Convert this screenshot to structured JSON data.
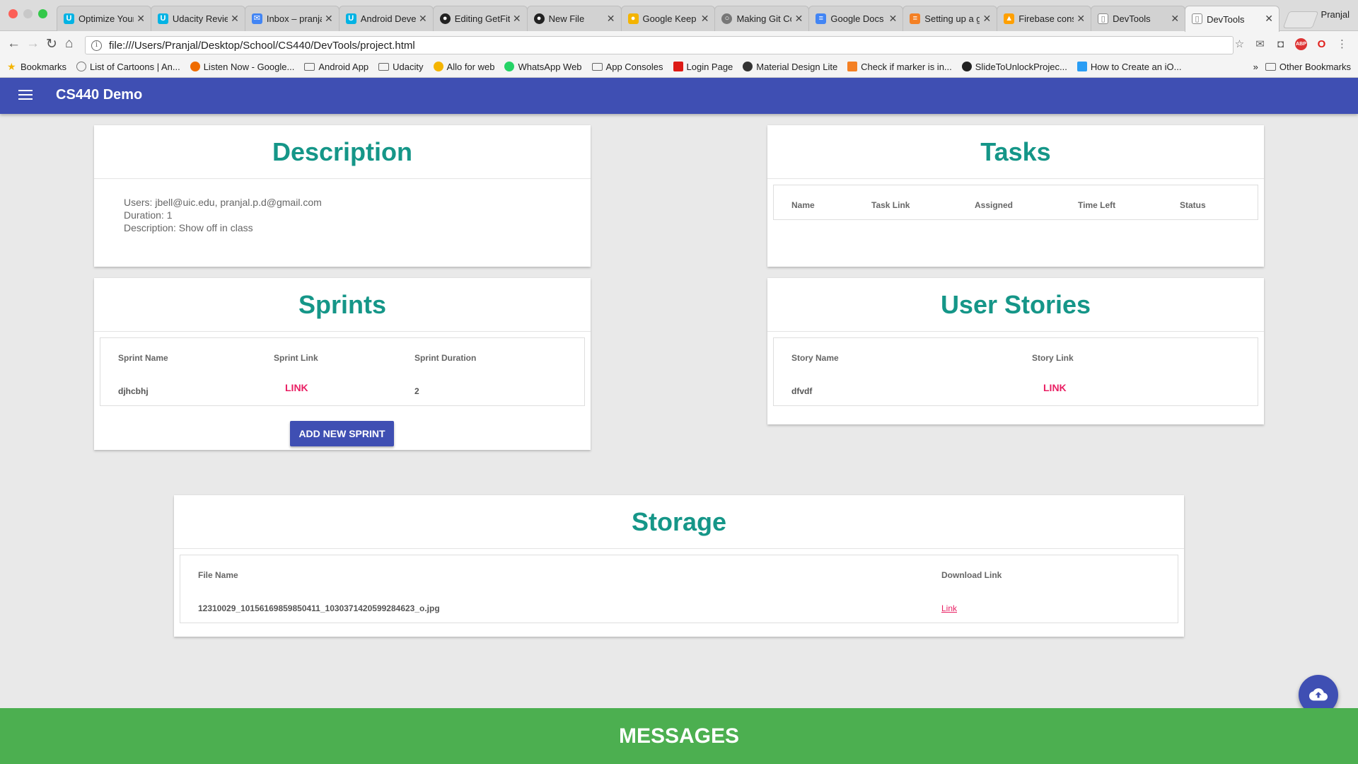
{
  "browser": {
    "tabs": [
      {
        "label": "Optimize Your",
        "color": "#02b3e4",
        "glyph": "U",
        "active": false
      },
      {
        "label": "Udacity Revie",
        "color": "#02b3e4",
        "glyph": "U",
        "active": false
      },
      {
        "label": "Inbox – pranjal",
        "color": "#4285f4",
        "glyph": "✉",
        "active": false
      },
      {
        "label": "Android Devel",
        "color": "#02b3e4",
        "glyph": "U",
        "active": false
      },
      {
        "label": "Editing GetFit",
        "color": "#222222",
        "glyph": "●",
        "active": false
      },
      {
        "label": "New File",
        "color": "#222222",
        "glyph": "●",
        "active": false
      },
      {
        "label": "Google Keep",
        "color": "#f4b400",
        "glyph": "●",
        "active": false
      },
      {
        "label": "Making Git Co",
        "color": "#555555",
        "glyph": "○",
        "active": false
      },
      {
        "label": "Google Docs",
        "color": "#4285f4",
        "glyph": "≡",
        "active": false
      },
      {
        "label": "Setting up a g",
        "color": "#f48024",
        "glyph": "≡",
        "active": false
      },
      {
        "label": "Firebase cons",
        "color": "#ffa000",
        "glyph": "▲",
        "active": false
      },
      {
        "label": "DevTools",
        "color": "#888888",
        "glyph": "▯",
        "active": false
      },
      {
        "label": "DevTools",
        "color": "#888888",
        "glyph": "▯",
        "active": true
      }
    ],
    "profile": "Pranjal",
    "url": "file:///Users/Pranjal/Desktop/School/CS440/DevTools/project.html",
    "bookmarks": [
      {
        "label": "Bookmarks",
        "type": "star"
      },
      {
        "label": "List of Cartoons | An...",
        "type": "circle"
      },
      {
        "label": "Listen Now - Google...",
        "type": "orange"
      },
      {
        "label": "Android App",
        "type": "folder"
      },
      {
        "label": "Udacity",
        "type": "folder"
      },
      {
        "label": "Allo for web",
        "type": "yellow"
      },
      {
        "label": "WhatsApp Web",
        "type": "green"
      },
      {
        "label": "App Consoles",
        "type": "folder"
      },
      {
        "label": "Login Page",
        "type": "red"
      },
      {
        "label": "Material Design Lite",
        "type": "dark"
      },
      {
        "label": "Check if marker is in...",
        "type": "so"
      },
      {
        "label": "SlideToUnlockProjec...",
        "type": "dark"
      },
      {
        "label": "How to Create an iO...",
        "type": "blue"
      }
    ],
    "bookmarks_more": "»",
    "other_bookmarks": "Other Bookmarks"
  },
  "app": {
    "title": "CS440 Demo",
    "description": {
      "title": "Description",
      "users": "Users: jbell@uic.edu, pranjal.p.d@gmail.com",
      "duration": "Duration: 1",
      "description": "Description: Show off in class"
    },
    "tasks": {
      "title": "Tasks",
      "columns": [
        "Name",
        "Task Link",
        "Assigned",
        "Time Left",
        "Status"
      ]
    },
    "sprints": {
      "title": "Sprints",
      "columns": [
        "Sprint Name",
        "Sprint Link",
        "Sprint Duration"
      ],
      "rows": [
        {
          "name": "djhcbhj",
          "link": "LINK",
          "duration": "2"
        }
      ],
      "add_button": "ADD NEW SPRINT"
    },
    "user_stories": {
      "title": "User Stories",
      "columns": [
        "Story Name",
        "Story Link"
      ],
      "rows": [
        {
          "name": "dfvdf",
          "link": "LINK"
        }
      ]
    },
    "storage": {
      "title": "Storage",
      "columns": [
        "File Name",
        "Download Link"
      ],
      "rows": [
        {
          "file": "12310029_10156169859850411_1030371420599284623_o.jpg",
          "link": "Link"
        }
      ]
    },
    "messages_label": "MESSAGES",
    "fab_icon": "cloud-upload-icon"
  },
  "colors": {
    "primary": "#3f4fb3",
    "accent": "#e91f63",
    "title_teal": "#159688",
    "messages_green": "#4caf50"
  }
}
